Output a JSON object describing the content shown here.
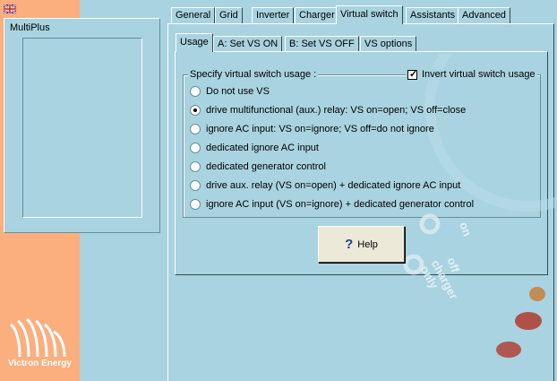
{
  "sidebar": {
    "device_label": "MultiPlus",
    "brand": "Victron Energy"
  },
  "tabs": [
    "General",
    "Grid",
    "Inverter",
    "Charger",
    "Virtual switch",
    "Assistants",
    "Advanced"
  ],
  "active_tab": "Virtual switch",
  "subtabs": [
    "Usage",
    "A:  Set VS ON",
    "B:  Set VS OFF",
    "VS options"
  ],
  "active_subtab": "Usage",
  "usage": {
    "group_title": "Specify virtual switch usage :",
    "invert_label": "Invert virtual switch usage",
    "invert_checked": true,
    "options": [
      "Do not use VS",
      "drive multifunctional (aux.) relay: VS on=open; VS off=close",
      "ignore AC input: VS on=ignore;  VS off=do not ignore",
      "dedicated ignore AC input",
      "dedicated generator control",
      "drive aux. relay (VS on=open) + dedicated ignore AC input",
      "ignore AC input (VS on=ignore) + dedicated generator control"
    ],
    "selected_index": 1
  },
  "help_label": "Help",
  "background_watermark": [
    "on",
    "off",
    "charger only"
  ],
  "colors": {
    "window_bg": "#a9d3e0",
    "sidebar_orange": "#fbae7e",
    "button_face": "#ece9d8"
  }
}
